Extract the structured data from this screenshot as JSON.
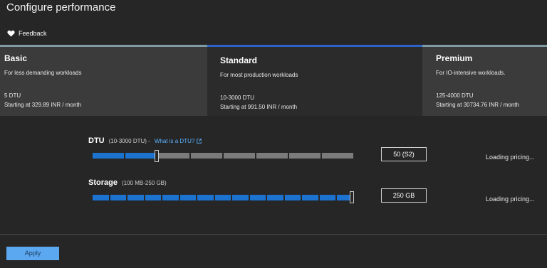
{
  "header": {
    "title": "Configure performance",
    "feedback_label": "Feedback",
    "feedback_icon": "heart-icon"
  },
  "tiers": [
    {
      "name": "Basic",
      "description": "For less demanding workloads",
      "range": "5 DTU",
      "price": "Starting at 329.89 INR / month",
      "selected": false
    },
    {
      "name": "Standard",
      "description": "For most production workloads",
      "range": "10-3000 DTU",
      "price": "Starting at 991.50 INR / month",
      "selected": true
    },
    {
      "name": "Premium",
      "description": "For IO-intensive workloads.",
      "range": "125-4000 DTU",
      "price": "Starting at 30734.76 INR / month",
      "selected": false
    }
  ],
  "dtu": {
    "label": "DTU",
    "range_hint": "(10-3000 DTU)  -",
    "link_text": "What is a DTU?",
    "link_icon": "external-link-icon",
    "value": "50 (S2)",
    "pricing": "Loading pricing...",
    "segments": 8,
    "filled_segments": 2
  },
  "storage": {
    "label": "Storage",
    "range_hint": "(100 MB-250 GB)",
    "value": "250 GB",
    "pricing": "Loading pricing...",
    "segments": 15,
    "filled_segments": 15
  },
  "footer": {
    "apply_label": "Apply"
  },
  "colors": {
    "accent": "#1c73cf",
    "selected_tier_bar": "#2d63c6",
    "apply_button": "#5ba7f0",
    "link": "#5ab2ff"
  }
}
